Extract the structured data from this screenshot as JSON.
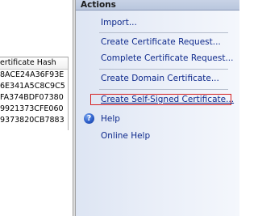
{
  "table": {
    "header": "ertificate Hash",
    "rows": [
      "8ACE24A36F93E",
      "6E341A5C8C9C5",
      "FA374BDF07380",
      "9921373CFE060",
      "9373820CB7883"
    ]
  },
  "actions": {
    "title": "Actions",
    "items": [
      {
        "label": "Import..."
      },
      {
        "label": "Create Certificate Request..."
      },
      {
        "label": "Complete Certificate Request..."
      },
      {
        "label": "Create Domain Certificate..."
      },
      {
        "label": "Create Self-Signed Certificate..."
      },
      {
        "label": "Help"
      },
      {
        "label": "Online Help"
      }
    ],
    "help_icon_glyph": "?"
  },
  "colors": {
    "link": "#0f2a8c",
    "highlight_box": "#d62020",
    "panel_bg": "#e9eef8"
  }
}
